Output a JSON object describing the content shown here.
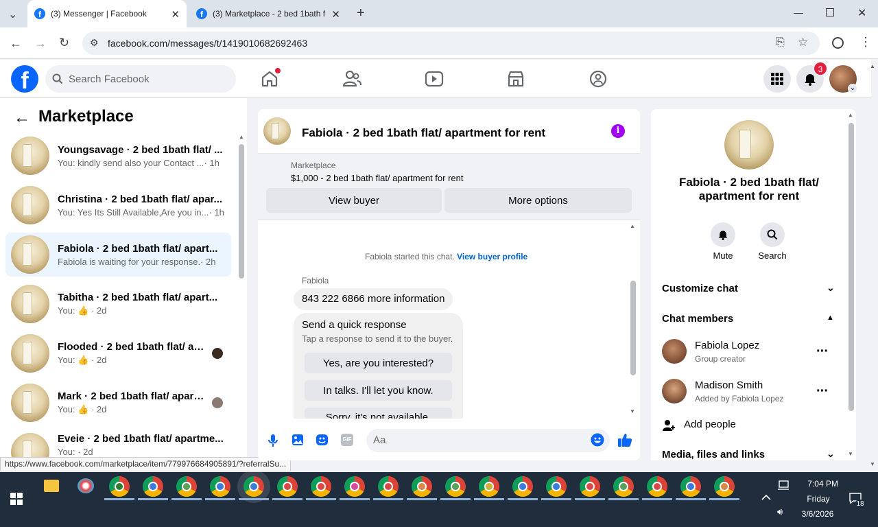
{
  "browser": {
    "tabs": [
      {
        "title": "(3) Messenger | Facebook",
        "active": true
      },
      {
        "title": "(3) Marketplace - 2 bed 1bath f",
        "active": false
      }
    ],
    "url": "facebook.com/messages/t/1419010682692463",
    "status_url": "https://www.facebook.com/marketplace/item/779976684905891/?referralSu..."
  },
  "fb_header": {
    "search_placeholder": "Search Facebook",
    "notification_count": "3"
  },
  "left": {
    "title": "Marketplace",
    "conversations": [
      {
        "title": "Youngsavage · 2 bed 1bath flat/ ...",
        "preview": "You: kindly send also your Contact ...",
        "time": "· 1h",
        "selected": false
      },
      {
        "title": "Christina · 2 bed 1bath flat/ apar...",
        "preview": "You: Yes Its Still Available,Are you in...",
        "time": "· 1h",
        "selected": false
      },
      {
        "title": "Fabiola · 2 bed 1bath flat/ apart...",
        "preview": "Fabiola is waiting for your response.",
        "time": "· 2h",
        "selected": true
      },
      {
        "title": "Tabitha · 2 bed 1bath flat/ apart...",
        "preview": "You:",
        "time": "· 2d",
        "selected": false
      },
      {
        "title": "Flooded · 2 bed 1bath flat/ ap...",
        "preview": "You:",
        "time": "· 2d",
        "selected": false
      },
      {
        "title": "Mark · 2 bed 1bath flat/ apart...",
        "preview": "You:",
        "time": "· 2d",
        "selected": false
      },
      {
        "title": "Eveie · 2 bed 1bath flat/ apartme...",
        "preview": "You:",
        "time": "· 2d",
        "selected": false
      }
    ]
  },
  "chat": {
    "title": "Fabiola · 2 bed 1bath flat/ apartment for rent",
    "listing_label": "Marketplace",
    "listing_desc": "$1,000 - 2 bed 1bath flat/ apartment for rent",
    "view_buyer": "View buyer",
    "more_options": "More options",
    "started_text": "Fabiola started this chat.",
    "view_buyer_profile": "View buyer profile",
    "sender": "Fabiola",
    "message": "843 222 6866 more information",
    "quick_title": "Send a quick response",
    "quick_sub": "Tap a response to send it to the buyer.",
    "quick_responses": [
      "Yes, are you interested?",
      "In talks. I'll let you know.",
      "Sorry, it's not available."
    ],
    "composer_placeholder": "Aa"
  },
  "right": {
    "title": "Fabiola · 2 bed 1bath flat/ apartment for rent",
    "mute": "Mute",
    "search": "Search",
    "customize_chat": "Customize chat",
    "chat_members": "Chat members",
    "members": [
      {
        "name": "Fabiola Lopez",
        "role": "Group creator"
      },
      {
        "name": "Madison Smith",
        "role": "Added by Fabiola Lopez"
      }
    ],
    "add_people": "Add people",
    "media": "Media, files and links"
  },
  "taskbar": {
    "time": "7:04 PM",
    "day": "Friday",
    "date": "3/6/2026",
    "notif_count": "18"
  },
  "colors": {
    "fb_blue": "#0866ff",
    "link_blue": "#0064d1",
    "info_purple": "#a100f5",
    "notif_red": "#e41e3f"
  }
}
